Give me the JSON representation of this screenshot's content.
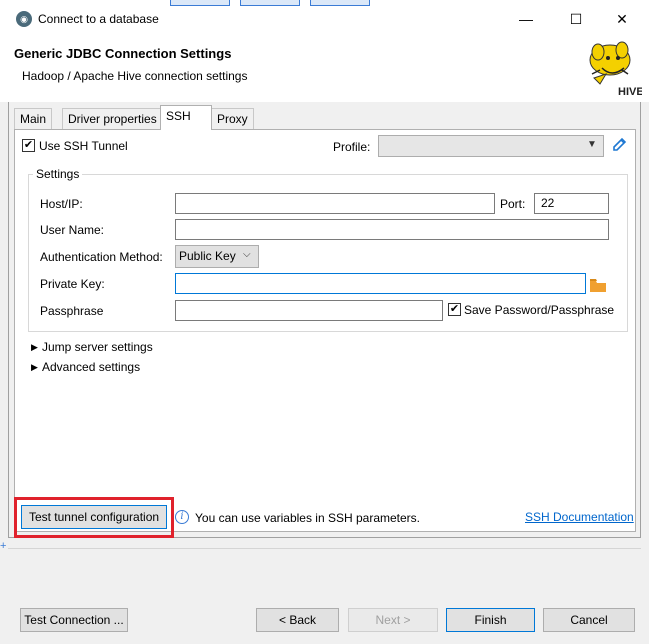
{
  "window": {
    "title": "Connect to a database",
    "controls": {
      "minimize": "—",
      "maximize": "☐",
      "close": "✕"
    }
  },
  "header": {
    "title": "Generic JDBC Connection Settings",
    "subtitle": "Hadoop / Apache Hive connection settings",
    "logo_text": "HIVE"
  },
  "tabs": [
    {
      "label": "Main",
      "active": false
    },
    {
      "label": "Driver properties",
      "active": false
    },
    {
      "label": "SSH",
      "active": true
    },
    {
      "label": "Proxy",
      "active": false
    }
  ],
  "ssh": {
    "use_tunnel_label": "Use SSH Tunnel",
    "use_tunnel_checked": true,
    "profile_label": "Profile:",
    "profile_value": "",
    "settings_group_label": "Settings",
    "host_label": "Host/IP:",
    "host_value": "",
    "port_label": "Port:",
    "port_value": "22",
    "username_label": "User Name:",
    "username_value": "",
    "auth_label": "Authentication Method:",
    "auth_value": "Public Key",
    "private_key_label": "Private Key:",
    "private_key_value": "",
    "passphrase_label": "Passphrase",
    "passphrase_value": "",
    "save_password_label": "Save Password/Passphrase",
    "save_password_checked": true,
    "jump_server_label": "Jump server settings",
    "advanced_label": "Advanced settings",
    "test_tunnel_label": "Test tunnel configuration",
    "info_text": "You can use variables in SSH parameters.",
    "doc_link": "SSH Documentation"
  },
  "footer": {
    "test_connection": "Test Connection ...",
    "back": "< Back",
    "next": "Next >",
    "finish": "Finish",
    "cancel": "Cancel"
  },
  "colors": {
    "accent": "#0078d7",
    "highlight": "#e0222c",
    "link": "#0066cc",
    "folder": "#f0a030",
    "logo_yellow": "#f4d000"
  }
}
